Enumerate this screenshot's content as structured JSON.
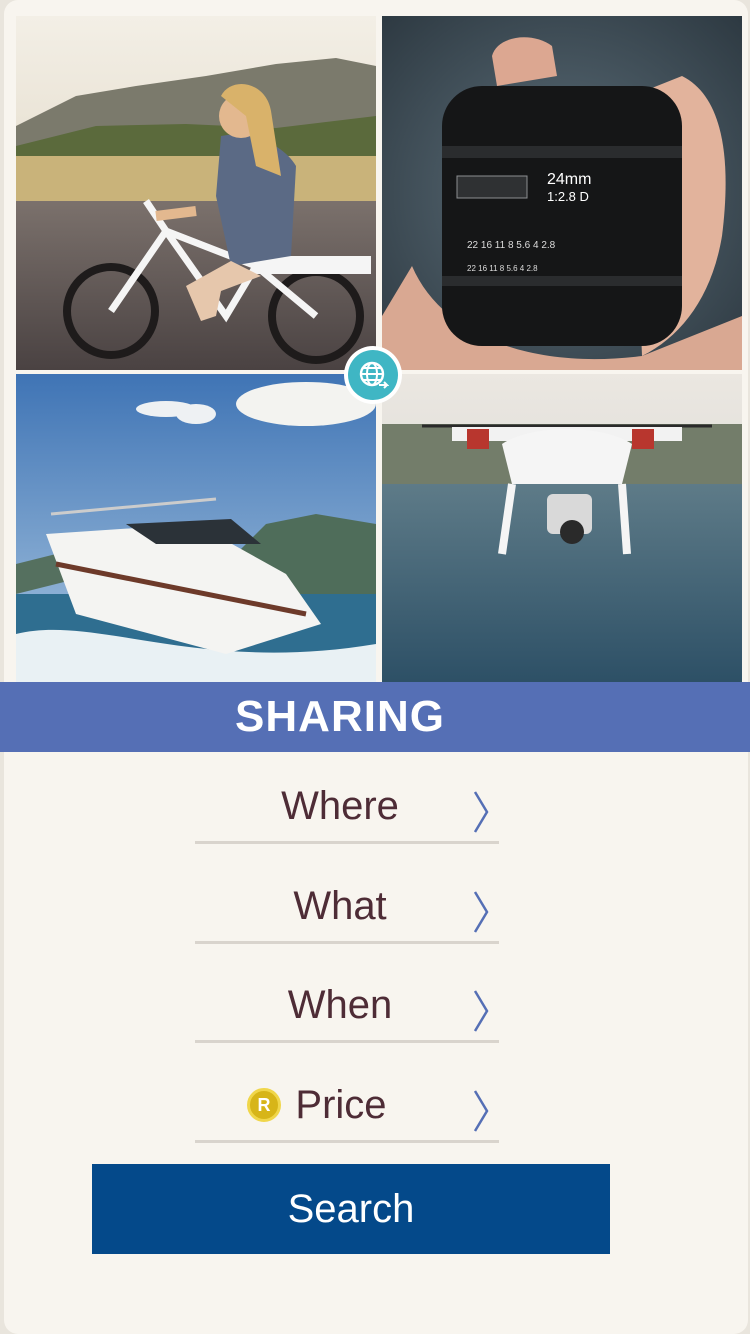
{
  "banner": {
    "title": "SHARING"
  },
  "fields": {
    "where": "Where",
    "what": "What",
    "when": "When",
    "price": "Price"
  },
  "price_coin_glyph": "R",
  "search_button": "Search",
  "tiles": [
    {
      "name": "woman-on-electric-bike-photo"
    },
    {
      "name": "camera-lens-in-hand-photo",
      "lens_text": "24mm",
      "lens_sub": "1:2.8 D"
    },
    {
      "name": "speedboat-photo"
    },
    {
      "name": "drone-over-water-photo"
    }
  ],
  "colors": {
    "banner": "#556fb5",
    "search_button": "#04498a",
    "field_text": "#4e2c36",
    "chevron": "#556fb5",
    "badge": "#3fb6c4",
    "coin": "#d7b518"
  },
  "icons": {
    "center_badge": "globe-share-icon",
    "chevron": "chevron-right-icon",
    "price": "coin-icon"
  }
}
